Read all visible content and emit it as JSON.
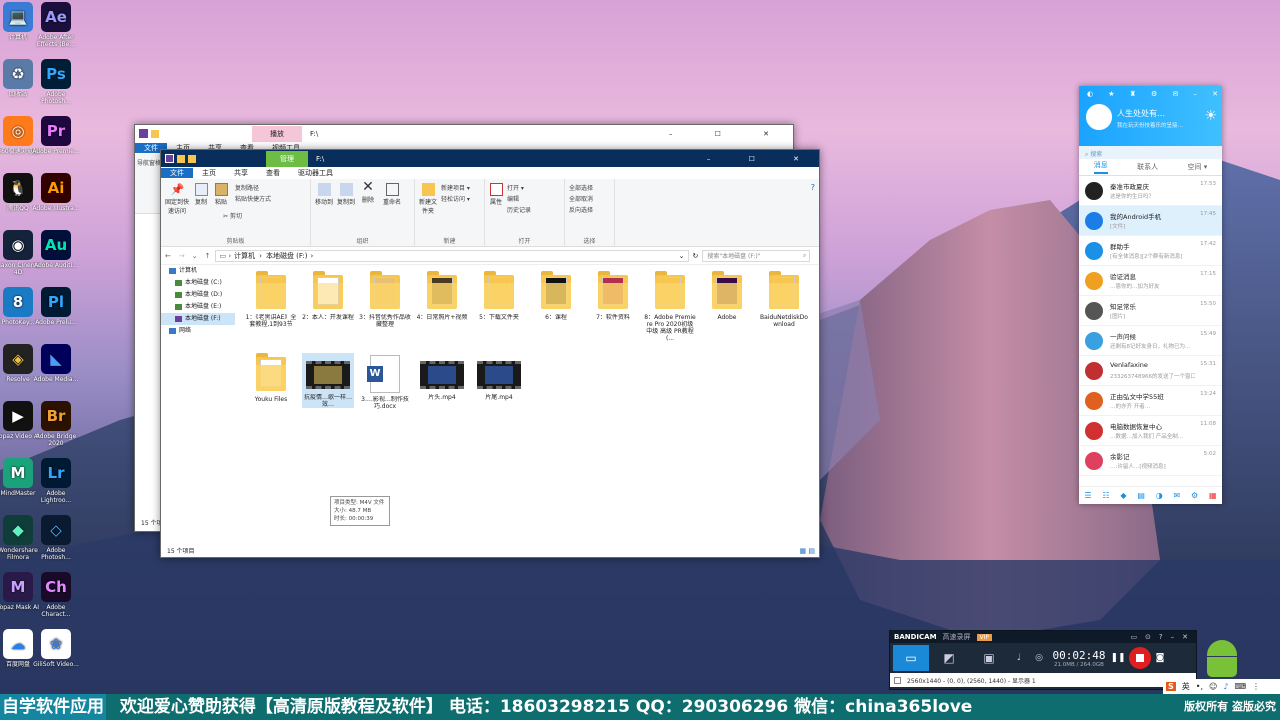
{
  "desktop": {
    "icons": [
      {
        "label": "计算机",
        "glyph": "💻",
        "bg": "#3a7bd5",
        "color": "#fff"
      },
      {
        "label": "Adobe After Effects (Be...",
        "glyph": "Ae",
        "bg": "#1a0f3d",
        "color": "#9b9bff"
      },
      {
        "label": "回收站",
        "glyph": "♻",
        "bg": "#5a7aa8",
        "color": "#fff"
      },
      {
        "label": "Adobe Photosh...",
        "glyph": "Ps",
        "bg": "#001e36",
        "color": "#31a8ff"
      },
      {
        "label": "360极速浏览器",
        "glyph": "◎",
        "bg": "#ff7a1a",
        "color": "#fff"
      },
      {
        "label": "Adobe Premie...",
        "glyph": "Pr",
        "bg": "#1f0740",
        "color": "#ea77ff"
      },
      {
        "label": "腾讯QQ",
        "glyph": "🐧",
        "bg": "#111",
        "color": "#fff"
      },
      {
        "label": "Adobe Illustra...",
        "glyph": "Ai",
        "bg": "#330000",
        "color": "#ff9a00"
      },
      {
        "label": "Maxon Cinema 4D",
        "glyph": "◉",
        "bg": "#14223a",
        "color": "#fff"
      },
      {
        "label": "Adobe Auditi...",
        "glyph": "Au",
        "bg": "#00103a",
        "color": "#00e4bb"
      },
      {
        "label": "PhotoKey...",
        "glyph": "8",
        "bg": "#1a7ac4",
        "color": "#fff"
      },
      {
        "label": "Adobe Prelu...",
        "glyph": "Pl",
        "bg": "#001a33",
        "color": "#2fa8ff"
      },
      {
        "label": "Resolve",
        "glyph": "◈",
        "bg": "#222",
        "color": "#f0c040"
      },
      {
        "label": "Adobe Media...",
        "glyph": "◣",
        "bg": "#00005b",
        "color": "#4d9bff"
      },
      {
        "label": "Topaz Video AI",
        "glyph": "▶",
        "bg": "#111",
        "color": "#fff"
      },
      {
        "label": "Adobe Bridge 2020",
        "glyph": "Br",
        "bg": "#2b1100",
        "color": "#f0a030"
      },
      {
        "label": "MindMaster",
        "glyph": "M",
        "bg": "#1aa37a",
        "color": "#fff"
      },
      {
        "label": "Adobe Lightroo...",
        "glyph": "Lr",
        "bg": "#001a33",
        "color": "#31a8ff"
      },
      {
        "label": "Wondershare Filmora",
        "glyph": "◆",
        "bg": "#0f3d3a",
        "color": "#5ff0c0"
      },
      {
        "label": "Adobe Photosh...",
        "glyph": "◇",
        "bg": "#0a1a30",
        "color": "#4db8ff"
      },
      {
        "label": "Topaz Mask AI",
        "glyph": "M",
        "bg": "#2a1a4a",
        "color": "#c9a0ff"
      },
      {
        "label": "Adobe Charact...",
        "glyph": "Ch",
        "bg": "#1a0a2a",
        "color": "#e08aff"
      },
      {
        "label": "百度网盘",
        "glyph": "☁",
        "bg": "#fff",
        "color": "#2a7ff0"
      },
      {
        "label": "GiliSoft Video...",
        "glyph": "❀",
        "bg": "#fff",
        "color": "#3a7bd5"
      }
    ]
  },
  "back_window": {
    "tab_play": "播放",
    "path": "F:\\",
    "menu": [
      "文件",
      "主页",
      "共享",
      "查看",
      "视频工具"
    ],
    "nav_label": "导航窗格",
    "status": "15 个项目"
  },
  "explorer": {
    "title": "F:\\",
    "manage_tab": "管理",
    "menu": [
      "文件",
      "主页",
      "共享",
      "查看",
      "驱动器工具"
    ],
    "ribbon": {
      "pin": "固定到快速访问",
      "copy": "复制",
      "paste": "粘贴",
      "copy_path": "复制路径",
      "paste_shortcut": "粘贴快捷方式",
      "cut": "剪切",
      "clipboard": "剪贴板",
      "move_to": "移动到",
      "copy_to": "复制到",
      "delete": "删除",
      "rename": "重命名",
      "organize": "组织",
      "new_folder": "新建文件夹",
      "new_item": "新建项目 ▾",
      "easy_access": "轻松访问 ▾",
      "new": "新建",
      "properties": "属性",
      "open": "打开 ▾",
      "edit": "编辑",
      "history": "历史记录",
      "open_group": "打开",
      "select_all": "全部选择",
      "select_none": "全部取消",
      "invert": "反向选择",
      "select": "选择"
    },
    "breadcrumb": [
      "计算机",
      "本地磁盘 (F:)"
    ],
    "search_placeholder": "搜索\"本地磁盘 (F:)\"",
    "nav": [
      "计算机",
      "本地磁盘 (C:)",
      "本地磁盘 (D:)",
      "本地磁盘 (E:)",
      "本地磁盘 (F:)",
      "网络"
    ],
    "files": [
      {
        "name": "1：《老黑讲AE》全套教程,1到93节",
        "kind": "folder"
      },
      {
        "name": "2：本人：开发课程",
        "kind": "folder"
      },
      {
        "name": "3：抖音优秀作品收藏整理",
        "kind": "folder"
      },
      {
        "name": "4：日常照片+视频",
        "kind": "folder"
      },
      {
        "name": "5：下载文件夹",
        "kind": "folder"
      },
      {
        "name": "6：课程",
        "kind": "folder"
      },
      {
        "name": "7：软件资料",
        "kind": "folder"
      },
      {
        "name": "8：Adobe Premiere Pro 2020初级 中级 高级 PR教程(...",
        "kind": "folder"
      },
      {
        "name": "Adobe",
        "kind": "folder"
      },
      {
        "name": "BaiduNetdiskDownload",
        "kind": "folder"
      },
      {
        "name": "Youku Files",
        "kind": "folder"
      },
      {
        "name": "抗疫情…歌一样…效…",
        "kind": "video"
      },
      {
        "name": "3.…影视…制作技巧.docx",
        "kind": "word"
      },
      {
        "name": "片头.mp4",
        "kind": "video"
      },
      {
        "name": "片尾.mp4",
        "kind": "video"
      }
    ],
    "tooltip": {
      "type": "项目类型: M4V 文件",
      "size": "大小: 48.7 MB",
      "duration": "时长: 00:00:39"
    },
    "status": "15 个项目"
  },
  "qq": {
    "nickname": "人生处处有…",
    "signature": "我在玩天份技着乐的呈接…",
    "search": "搜索",
    "tabs": [
      "消息",
      "联系人",
      "空间 ▾"
    ],
    "rows": [
      {
        "name": "秦准市政夏庆",
        "msg": "这是你的生日吗？",
        "time": "17:53",
        "color": "#222"
      },
      {
        "name": "我的Android手机",
        "msg": "[文件]",
        "time": "17:45",
        "color": "#1a7ee6"
      },
      {
        "name": "群助手",
        "msg": "[有全体消息][2个群有新消息]",
        "time": "17:42",
        "color": "#1a90e6"
      },
      {
        "name": "验证消息",
        "msg": "…恩你的…加为好友",
        "time": "17:15",
        "color": "#f0a020"
      },
      {
        "name": "知足常乐",
        "msg": "[图片]",
        "time": "15:50",
        "color": "#555"
      },
      {
        "name": "一声问候",
        "msg": "还剩有8记好友身日，礼物已为…",
        "time": "15:49",
        "color": "#3aa0e0"
      },
      {
        "name": "Venlafaxine",
        "msg": "233263748966的发送了一个窗口抖动…",
        "time": "15:31",
        "color": "#c03030"
      },
      {
        "name": "正由弘文中学55班",
        "msg": "…的亦齐 开者…",
        "time": "13:24",
        "color": "#e06020"
      },
      {
        "name": "电脑数据恢复中心",
        "msg": "…数据…加入我们 产品全制…",
        "time": "11:08",
        "color": "#d03030"
      },
      {
        "name": "余影记",
        "msg": "…:许留人…[视频消息]",
        "time": "5:02",
        "color": "#e04060"
      }
    ]
  },
  "bandicam": {
    "brand": "BANDICAM",
    "mode": "高速录屏",
    "vip": "VIP",
    "timer": "00:02:48",
    "size": "21.0MB / 264.0GB",
    "info": "2560x1440 - (0, 0), (2560, 1440) - 显示器 1"
  },
  "banner": {
    "lead": "自学软件应用",
    "text": "欢迎爱心赞助获得【高清原版教程及软件】 电话：18603298215 QQ：290306296 微信：china365love",
    "right": "版权所有 盗版必究"
  },
  "tray": {
    "ime": "英"
  }
}
